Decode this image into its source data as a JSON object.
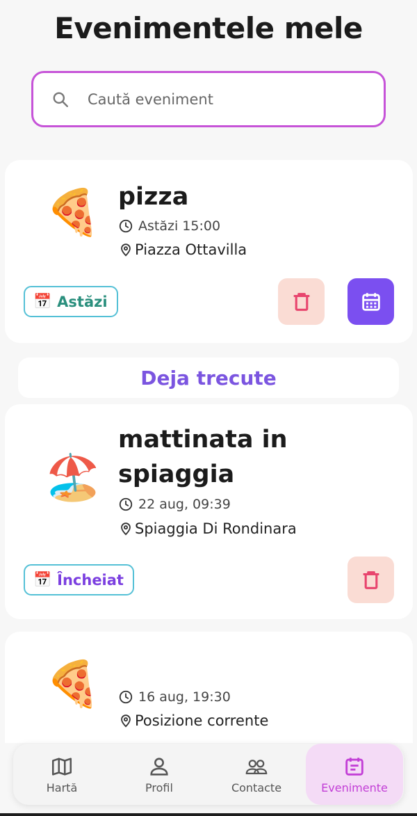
{
  "header": {
    "title": "Evenimentele mele"
  },
  "search": {
    "placeholder": "Caută eveniment",
    "value": ""
  },
  "section_past": {
    "label": "Deja trecute"
  },
  "events": [
    {
      "emoji": "🍕",
      "title": "pizza",
      "time": "Astăzi 15:00",
      "location": "Piazza Ottavilla",
      "badge_icon": "📅",
      "badge_label": "Astăzi",
      "badge_color": "#2a8f7d"
    },
    {
      "emoji": "🏖️",
      "title": "mattinata in spiaggia",
      "time": "22 aug, 09:39",
      "location": "Spiaggia Di Rondinara",
      "badge_icon": "📅",
      "badge_label": "Încheiat",
      "badge_color": "#7b3fe0"
    },
    {
      "emoji": "🍕",
      "title": "",
      "time": "16 aug, 19:30",
      "location": "Posizione corrente"
    }
  ],
  "nav": {
    "items": [
      {
        "label": "Hartă",
        "icon": "map-icon"
      },
      {
        "label": "Profil",
        "icon": "user-icon"
      },
      {
        "label": "Contacte",
        "icon": "users-icon"
      },
      {
        "label": "Evenimente",
        "icon": "event-list-icon"
      }
    ],
    "active_color": "#c23ed6"
  }
}
